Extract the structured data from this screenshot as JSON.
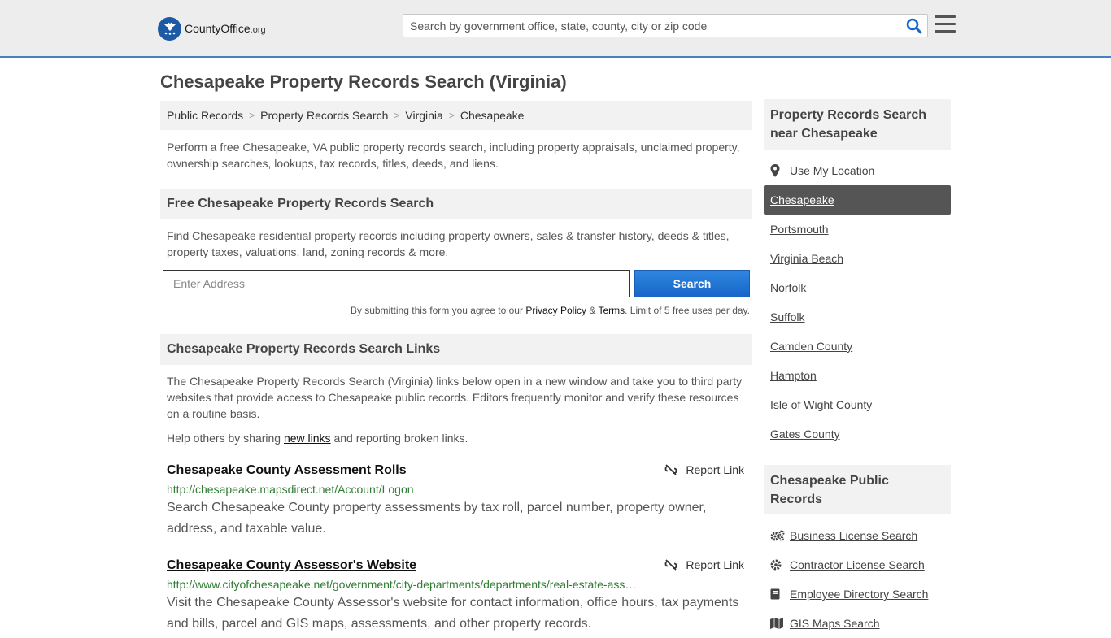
{
  "header": {
    "logo_main": "CountyOffice",
    "logo_suffix": ".org",
    "search_placeholder": "Search by government office, state, county, city or zip code"
  },
  "page_title": "Chesapeake Property Records Search (Virginia)",
  "breadcrumb": [
    "Public Records",
    "Property Records Search",
    "Virginia",
    "Chesapeake"
  ],
  "breadcrumb_sep": ">",
  "intro": "Perform a free Chesapeake, VA public property records search, including property appraisals, unclaimed property, ownership searches, lookups, tax records, titles, deeds, and liens.",
  "free_search": {
    "heading": "Free Chesapeake Property Records Search",
    "description": "Find Chesapeake residential property records including property owners, sales & transfer history, deeds & titles, property taxes, valuations, land, zoning records & more.",
    "address_placeholder": "Enter Address",
    "button_label": "Search",
    "disclaimer_pre": "By submitting this form you agree to our ",
    "privacy_label": "Privacy Policy",
    "amp": " & ",
    "terms_label": "Terms",
    "disclaimer_post": ". Limit of 5 free uses per day."
  },
  "links_section": {
    "heading": "Chesapeake Property Records Search Links",
    "description": "The Chesapeake Property Records Search (Virginia) links below open in a new window and take you to third party websites that provide access to Chesapeake public records. Editors frequently monitor and verify these resources on a routine basis.",
    "help_pre": "Help others by sharing ",
    "help_link": "new links",
    "help_post": " and reporting broken links.",
    "report_label": "Report Link",
    "entries": [
      {
        "title": "Chesapeake County Assessment Rolls",
        "url": "http://chesapeake.mapsdirect.net/Account/Logon",
        "description": "Search Chesapeake County property assessments by tax roll, parcel number, property owner, address, and taxable value."
      },
      {
        "title": "Chesapeake County Assessor's Website",
        "url": "http://www.cityofchesapeake.net/government/city-departments/departments/real-estate-ass…",
        "description": "Visit the Chesapeake County Assessor's website for contact information, office hours, tax payments and bills, parcel and GIS maps, assessments, and other property records."
      }
    ]
  },
  "sidebar": {
    "nearby_heading": "Property Records Search near Chesapeake",
    "use_location": "Use My Location",
    "nearby": [
      "Chesapeake",
      "Portsmouth",
      "Virginia Beach",
      "Norfolk",
      "Suffolk",
      "Camden County",
      "Hampton",
      "Isle of Wight County",
      "Gates County"
    ],
    "active_index": 0,
    "public_heading": "Chesapeake Public Records",
    "public_items": [
      {
        "label": "Business License Search",
        "icon": "gears-icon"
      },
      {
        "label": "Contractor License Search",
        "icon": "gear-icon"
      },
      {
        "label": "Employee Directory Search",
        "icon": "book-icon"
      },
      {
        "label": "GIS Maps Search",
        "icon": "map-icon"
      }
    ]
  },
  "colors": {
    "accent": "#1766c8",
    "url_green": "#2e7d32",
    "active_bg": "#555555"
  }
}
